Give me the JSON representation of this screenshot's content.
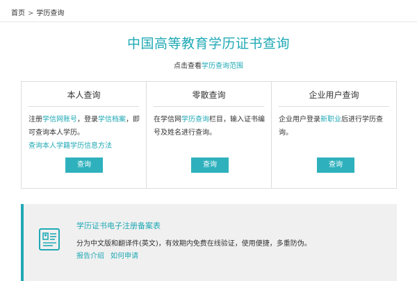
{
  "breadcrumb": {
    "home": "首页",
    "separator": ">",
    "current": "学历查询"
  },
  "header": {
    "title": "中国高等教育学历证书查询",
    "subtitle_prefix": "点击查看",
    "subtitle_link": "学历查询范围"
  },
  "cards": [
    {
      "title": "本人查询",
      "text": [
        {
          "t": "注册",
          "link": false
        },
        {
          "t": "学信网账号",
          "link": true
        },
        {
          "t": "，登录",
          "link": false
        },
        {
          "t": "学信档案",
          "link": true
        },
        {
          "t": "，即可查询本人学历。",
          "link": false
        }
      ],
      "extra_link": "查询本人学籍学历信息方法",
      "button": "查询"
    },
    {
      "title": "零散查询",
      "text": [
        {
          "t": "在学信网",
          "link": false
        },
        {
          "t": "学历查询",
          "link": true
        },
        {
          "t": "栏目，输入证书编号及姓名进行查询。",
          "link": false
        }
      ],
      "button": "查询"
    },
    {
      "title": "企业用户查询",
      "text": [
        {
          "t": "企业用户登录",
          "link": false
        },
        {
          "t": "新职业",
          "link": true
        },
        {
          "t": "后进行学历查询。",
          "link": false
        }
      ],
      "button": "查询"
    }
  ],
  "banner": {
    "title": "学历证书电子注册备案表",
    "description": "分为中文版和翻译件(英文)，有效期内免费在线验证，使用便捷，多重防伪。",
    "links": [
      "报告介绍",
      "如何申请"
    ],
    "icon": "certificate-icon"
  },
  "colors": {
    "accent": "#1fa9b5",
    "button": "#2fb1bd",
    "banner_bg": "#f0f0f0"
  }
}
